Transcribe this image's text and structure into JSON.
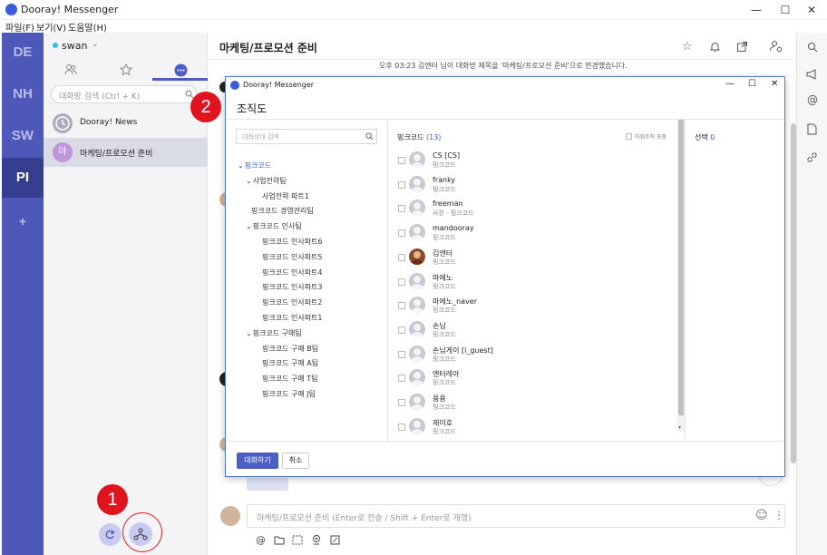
{
  "window": {
    "title": "Dooray! Messenger",
    "controls": {
      "minimize": "—",
      "maximize": "☐",
      "close": "✕"
    }
  },
  "menubar": [
    "파일(F)",
    "보기(V)",
    "도움말(H)"
  ],
  "workspaces": [
    {
      "code": "DE",
      "active": false
    },
    {
      "code": "NH",
      "active": false
    },
    {
      "code": "SW",
      "active": false
    },
    {
      "code": "PI",
      "active": true
    },
    {
      "code": "+",
      "active": false
    }
  ],
  "user": {
    "name": "swan",
    "status_color": "#2fbde0"
  },
  "channel_search": {
    "placeholder": "대화방 검색 (Ctrl + K)"
  },
  "channels": [
    {
      "name": "Dooray! News",
      "avatar_text": "",
      "active": false
    },
    {
      "name": "마케팅/프로모션 준비",
      "avatar_text": "마",
      "active": true
    }
  ],
  "main": {
    "title": "마케팅/프로모션 준비",
    "system_message": "오후 03:23  김엔터 님이 대화방 제목을 '마케팅/프로모션 준비'으로 변경했습니다.",
    "composer_placeholder": "마케팅/프로모션 준비  (Enter로 전송 / Shift + Enter로 개행)"
  },
  "dialog": {
    "window_title": "Dooray! Messenger",
    "heading": "조직도",
    "search_placeholder": "대화상대 검색",
    "org_tree": [
      {
        "label": "핑크코드",
        "level": 0,
        "selected": true
      },
      {
        "label": "사업전략팀",
        "level": 1
      },
      {
        "label": "사업전략 파트1",
        "level": 2
      },
      {
        "label": "핑크코드 경영관리팀",
        "level": 1
      },
      {
        "label": "핑크코드 인사팀",
        "level": 1
      },
      {
        "label": "핑크코드 인사파트6",
        "level": 2
      },
      {
        "label": "핑크코드 인사파트5",
        "level": 2
      },
      {
        "label": "핑크코드 인사파트4",
        "level": 2
      },
      {
        "label": "핑크코드 인사파트3",
        "level": 2
      },
      {
        "label": "핑크코드 인사파트2",
        "level": 2
      },
      {
        "label": "핑크코드 인사파트1",
        "level": 2
      },
      {
        "label": "핑크코드 구매팀",
        "level": 1
      },
      {
        "label": "핑크코드 구매 B팀",
        "level": 2
      },
      {
        "label": "핑크코드 구매 A팀",
        "level": 2
      },
      {
        "label": "핑크코드 구매 T팀",
        "level": 2
      },
      {
        "label": "핑크코드 구매 J팀",
        "level": 2
      }
    ],
    "members_header": {
      "org": "핑크코드",
      "count": "(13)",
      "include_sub": "하위조직 포함"
    },
    "members": [
      {
        "name": "CS [CS]",
        "dept": "핑크코드",
        "photo": false
      },
      {
        "name": "franky",
        "dept": "핑크코드",
        "photo": false
      },
      {
        "name": "freeman",
        "dept": "사장 - 핑크코드",
        "photo": false
      },
      {
        "name": "mandooray",
        "dept": "핑크코드",
        "photo": false
      },
      {
        "name": "김엔터",
        "dept": "핑크코드",
        "photo": true
      },
      {
        "name": "마에노",
        "dept": "핑크코드",
        "photo": false
      },
      {
        "name": "마에노_naver",
        "dept": "핑크코드",
        "photo": false
      },
      {
        "name": "손님",
        "dept": "핑크코드",
        "photo": false
      },
      {
        "name": "손님게이 [i_guest]",
        "dept": "핑크코드",
        "photo": false
      },
      {
        "name": "엔터레아",
        "dept": "핑크코드",
        "photo": false
      },
      {
        "name": "용용",
        "dept": "핑크코드",
        "photo": false
      },
      {
        "name": "제이호",
        "dept": "핑크코드",
        "photo": false
      }
    ],
    "selection": {
      "label": "선택",
      "count": "0"
    },
    "confirm_label": "대화하기",
    "cancel_label": "취소"
  },
  "markers": {
    "one": "1",
    "two": "2"
  },
  "colors": {
    "rail": "#4e58b8",
    "rail_active": "#353d8f",
    "accent": "#4b5ec2",
    "marker": "#e0141e"
  }
}
